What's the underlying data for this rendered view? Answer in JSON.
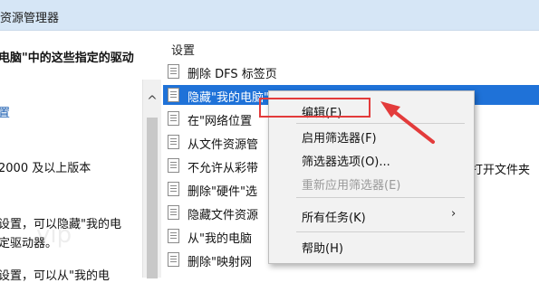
{
  "window": {
    "title": "资源管理器"
  },
  "left_pane": {
    "heading": "电脑\"中的这些指定的驱动",
    "link": "置",
    "requirement": "2000 及以上版本",
    "desc1": "设置，可以隐藏\"我的电",
    "desc2": "定驱动器。",
    "desc3": "设置，可以从\"我的电"
  },
  "settings": {
    "header": "设置",
    "rows": [
      "删除 DFS 标签页",
      "隐藏\"我的电脑\"中的这些指定的驱动器",
      "在\"网络位置",
      "从文件资源管",
      "不允许从彩带",
      "删除\"硬件\"选",
      "隐藏文件资源",
      "从\"我的电脑",
      "删除\"映射网"
    ],
    "row_tail": "打开文件夹"
  },
  "context_menu": {
    "items": {
      "edit": "编辑(E)",
      "enable_filter": "启用筛选器(F)",
      "filter_options": "筛选器选项(O)...",
      "reapply_filter": "重新应用筛选器(E)",
      "all_tasks": "所有任务(K)",
      "help": "帮助(H)"
    },
    "submenu_arrow": "›"
  },
  "scrollbar": {
    "up_arrow": "^"
  },
  "colors": {
    "selection": "#1f72d8",
    "annotation": "#e33b3b"
  }
}
